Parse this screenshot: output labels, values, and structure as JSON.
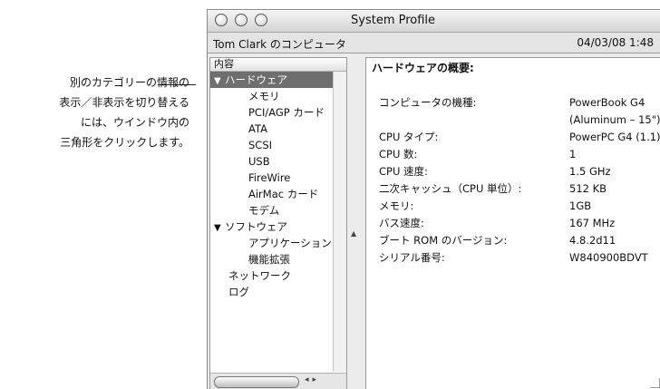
{
  "callout": {
    "lines": [
      "別のカテゴリーの情報の",
      "表示／非表示を切り替える",
      "には、ウインドウ内の",
      "三角形をクリックします。"
    ]
  },
  "window": {
    "title": "System Profile",
    "computer_name": "Tom Clark のコンピュータ",
    "datetime": "04/03/08 1:48"
  },
  "left_pane": {
    "column_header": "内容",
    "items": [
      {
        "label": "ハードウェア",
        "caret": "▼",
        "selected": true
      },
      {
        "label": "メモリ"
      },
      {
        "label": "PCI/AGP カード"
      },
      {
        "label": "ATA"
      },
      {
        "label": "SCSI"
      },
      {
        "label": "USB"
      },
      {
        "label": "FireWire"
      },
      {
        "label": "AirMac カード"
      },
      {
        "label": "モデム"
      },
      {
        "label": "ソフトウェア",
        "caret": "▼"
      },
      {
        "label": "アプリケーション"
      },
      {
        "label": "機能拡張"
      },
      {
        "label": "ネットワーク"
      },
      {
        "label": "ログ"
      }
    ]
  },
  "right_pane": {
    "header": "ハードウェアの概要:",
    "rows": [
      {
        "label": "コンピュータの機種:",
        "value": "PowerBook G4"
      },
      {
        "label": "",
        "value": "(Aluminum – 15\")"
      },
      {
        "label": "CPU タイプ:",
        "value": "PowerPC G4  (1.1)"
      },
      {
        "label": "CPU 数:",
        "value": "1"
      },
      {
        "label": "CPU 速度:",
        "value": "1.5 GHz"
      },
      {
        "label": "二次キャッシュ（CPU 単位）:",
        "value": "512 KB"
      },
      {
        "label": "メモリ:",
        "value": "1GB"
      },
      {
        "label": "バス速度:",
        "value": "167 MHz"
      },
      {
        "label": "ブート ROM のバージョン:",
        "value": "4.8.2d11"
      },
      {
        "label": "シリアル番号:",
        "value": "W840900BDVT"
      }
    ]
  }
}
